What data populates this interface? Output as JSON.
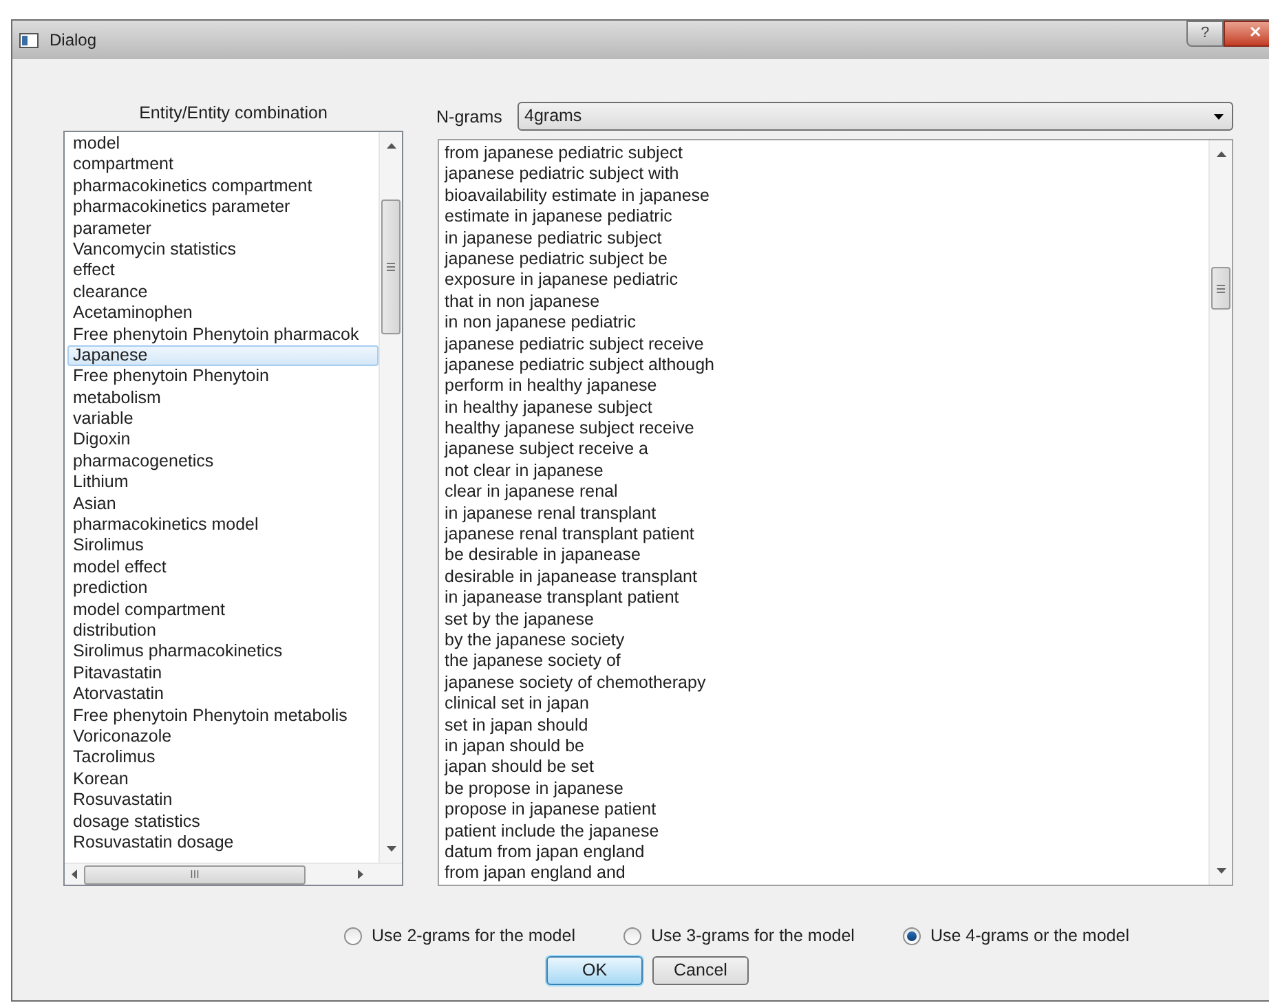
{
  "window": {
    "title": "Dialog",
    "help_button": "?",
    "close_button": "✕"
  },
  "entity_list": {
    "label": "Entity/Entity combination",
    "items": [
      {
        "text": "model",
        "selected": false
      },
      {
        "text": "compartment",
        "selected": false
      },
      {
        "text": "pharmacokinetics compartment",
        "selected": false
      },
      {
        "text": "pharmacokinetics parameter",
        "selected": false
      },
      {
        "text": "parameter",
        "selected": false
      },
      {
        "text": "Vancomycin statistics",
        "selected": false
      },
      {
        "text": "effect",
        "selected": false
      },
      {
        "text": "clearance",
        "selected": false
      },
      {
        "text": "Acetaminophen",
        "selected": false
      },
      {
        "text": "Free phenytoin Phenytoin pharmacok",
        "selected": false
      },
      {
        "text": "Japanese",
        "selected": true
      },
      {
        "text": "Free phenytoin Phenytoin",
        "selected": false
      },
      {
        "text": "metabolism",
        "selected": false
      },
      {
        "text": "variable",
        "selected": false
      },
      {
        "text": "Digoxin",
        "selected": false
      },
      {
        "text": "pharmacogenetics",
        "selected": false
      },
      {
        "text": "Lithium",
        "selected": false
      },
      {
        "text": "Asian",
        "selected": false
      },
      {
        "text": "pharmacokinetics model",
        "selected": false
      },
      {
        "text": "Sirolimus",
        "selected": false
      },
      {
        "text": "model effect",
        "selected": false
      },
      {
        "text": "prediction",
        "selected": false
      },
      {
        "text": "model compartment",
        "selected": false
      },
      {
        "text": "distribution",
        "selected": false
      },
      {
        "text": "Sirolimus pharmacokinetics",
        "selected": false
      },
      {
        "text": "Pitavastatin",
        "selected": false
      },
      {
        "text": "Atorvastatin",
        "selected": false
      },
      {
        "text": "Free phenytoin Phenytoin metabolis",
        "selected": false
      },
      {
        "text": "Voriconazole",
        "selected": false
      },
      {
        "text": "Tacrolimus",
        "selected": false
      },
      {
        "text": "Korean",
        "selected": false
      },
      {
        "text": "Rosuvastatin",
        "selected": false
      },
      {
        "text": "dosage statistics",
        "selected": false
      },
      {
        "text": "Rosuvastatin dosage",
        "selected": false
      }
    ],
    "hscroll_glyph": "III"
  },
  "ngrams": {
    "label": "N-grams",
    "value": "4grams",
    "lines": [
      "from japanese pediatric subject",
      "japanese pediatric subject with",
      "bioavailability estimate in japanese",
      "estimate in japanese pediatric",
      "in japanese pediatric subject",
      "japanese pediatric subject be",
      "exposure in japanese pediatric",
      "that in non japanese",
      "in non japanese pediatric",
      "japanese pediatric subject receive",
      "japanese pediatric subject although",
      "perform in healthy japanese",
      "in healthy japanese subject",
      "healthy japanese subject receive",
      "japanese subject receive a",
      "not clear in japanese",
      "clear in japanese renal",
      "in japanese renal transplant",
      "japanese renal transplant patient",
      "be desirable in japanease",
      "desirable in japanease transplant",
      "in japanease transplant patient",
      "set by the japanese",
      "by the japanese society",
      "the japanese society of",
      "japanese society of chemotherapy",
      "clinical set in japan",
      "set in japan should",
      "in japan should be",
      "japan should be set",
      "be propose in japanese",
      "propose in japanese patient",
      "patient include the japanese",
      "datum from japan england",
      "from japan england and"
    ]
  },
  "radios": [
    {
      "label": "Use 2-grams for the model",
      "selected": false
    },
    {
      "label": "Use 3-grams for the model",
      "selected": false
    },
    {
      "label": "Use 4-grams or the model",
      "selected": true
    }
  ],
  "buttons": [
    {
      "label": "OK",
      "kind": "default"
    },
    {
      "label": "Cancel",
      "kind": "normal"
    }
  ]
}
